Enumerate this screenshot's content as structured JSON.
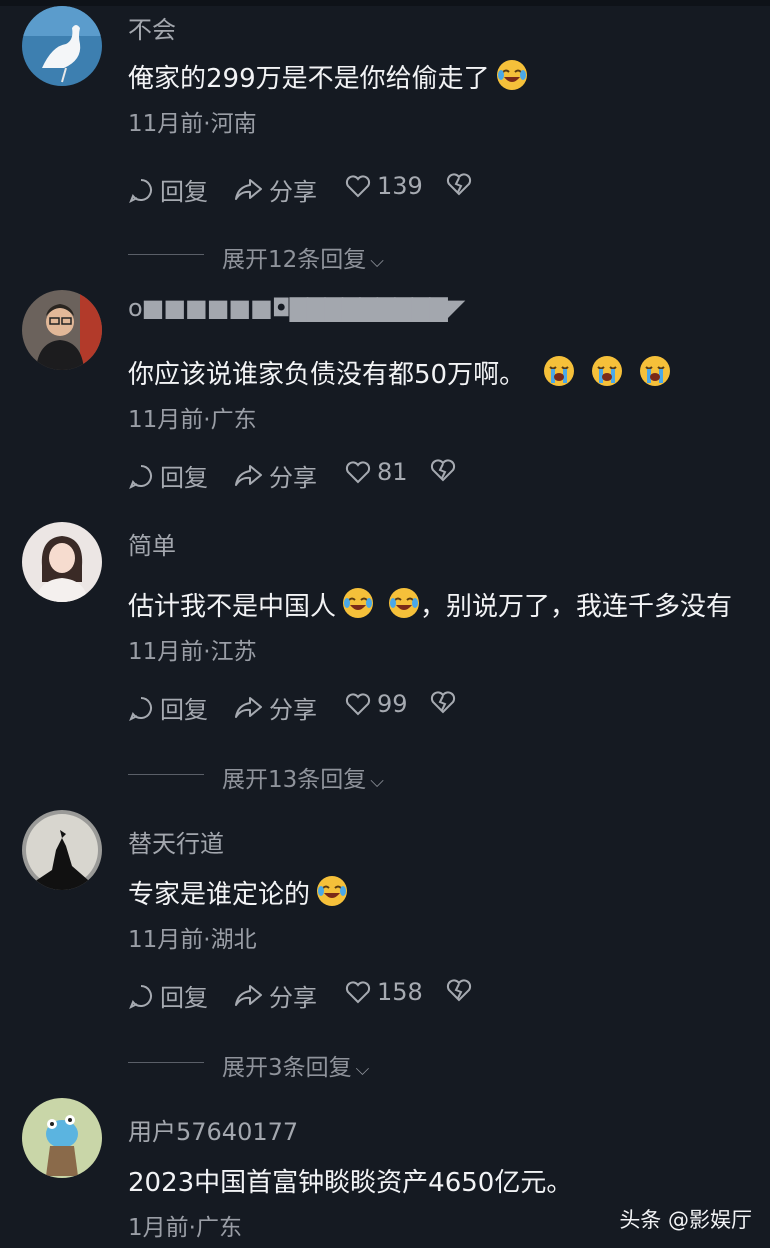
{
  "comments": [
    {
      "username": "不会",
      "text": "俺家的299万是不是你给偷走了",
      "meta": "11月前·河南",
      "reply_label": "回复",
      "share_label": "分享",
      "likes": "139",
      "expand": "展开12条回复"
    },
    {
      "username": "o■■■■■■◘▇▇▇▇▇▇▇▇▇◤",
      "text": "你应该说谁家负债没有都50万啊。",
      "meta": "11月前·广东",
      "reply_label": "回复",
      "share_label": "分享",
      "likes": "81"
    },
    {
      "username": "简单",
      "text": "估计我不是中国人",
      "text_after": "，别说万了，我连千多没有",
      "meta": "11月前·江苏",
      "reply_label": "回复",
      "share_label": "分享",
      "likes": "99",
      "expand": "展开13条回复"
    },
    {
      "username": "替天行道",
      "text": "专家是谁定论的",
      "meta": "11月前·湖北",
      "reply_label": "回复",
      "share_label": "分享",
      "likes": "158",
      "expand": "展开3条回复"
    },
    {
      "username": "用户57640177",
      "text": "2023中国首富钟睒睒资产4650亿元。",
      "meta": "1月前·广东"
    }
  ],
  "icons": {
    "reply": "reply-icon",
    "share": "share-icon",
    "like": "heart-icon",
    "dislike": "broken-heart-icon",
    "expand": "chevron-down-icon",
    "laugh": "laughing-tears-emoji",
    "cry": "crying-emoji"
  },
  "colors": {
    "background": "#151a22",
    "text": "#f2f3f5",
    "meta": "#9a9ea6"
  },
  "watermark": "头条 @影娱厅"
}
